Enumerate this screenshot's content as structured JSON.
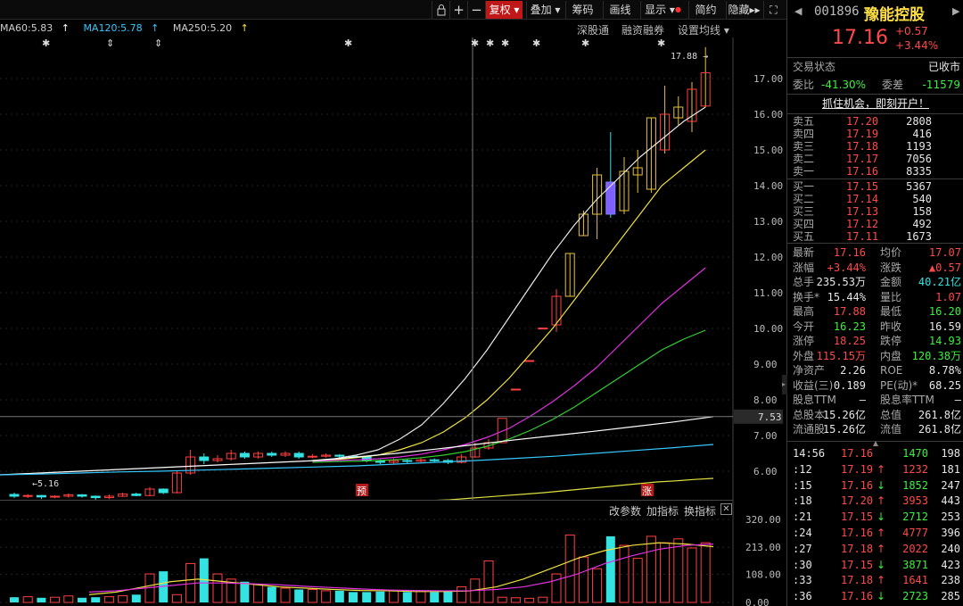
{
  "toolbar": {
    "fuquan": "复权",
    "overlay": "叠加",
    "chips": "筹码",
    "draw": "画线",
    "display": "显示",
    "simple": "简约",
    "hide": "隐藏"
  },
  "ma_legend": [
    {
      "label": "MA60:5.83",
      "color": "#ffffff"
    },
    {
      "label": "MA120:5.78",
      "color": "#35c8ff"
    },
    {
      "label": "MA250:5.20",
      "color": "#ffffff"
    }
  ],
  "links": {
    "sgt": "深股通",
    "margin": "融资融券",
    "ma_settings": "设置均线"
  },
  "kline": {
    "y_ticks": [
      "17.00",
      "16.00",
      "15.00",
      "14.00",
      "13.00",
      "12.00",
      "11.00",
      "10.00",
      "9.00",
      "8.00",
      "7.00",
      "6.00"
    ],
    "y_min": 5.4,
    "y_max": 17.9,
    "high_label": "17.88",
    "low_label": "5.16",
    "crosshair_value": "7.53",
    "markers": {
      "pre": "预",
      "up": "涨"
    },
    "candles": [
      [
        5.35,
        5.3,
        5.4,
        5.25
      ],
      [
        5.3,
        5.32,
        5.36,
        5.25
      ],
      [
        5.32,
        5.28,
        5.34,
        5.22
      ],
      [
        5.28,
        5.3,
        5.33,
        5.24
      ],
      [
        5.3,
        5.34,
        5.38,
        5.26
      ],
      [
        5.34,
        5.3,
        5.36,
        5.26
      ],
      [
        5.3,
        5.26,
        5.32,
        5.2
      ],
      [
        5.26,
        5.3,
        5.35,
        5.22
      ],
      [
        5.3,
        5.36,
        5.4,
        5.28
      ],
      [
        5.36,
        5.32,
        5.4,
        5.3
      ],
      [
        5.32,
        5.5,
        5.56,
        5.3
      ],
      [
        5.5,
        5.4,
        5.52,
        5.36
      ],
      [
        5.4,
        5.95,
        6.0,
        5.38
      ],
      [
        5.95,
        6.4,
        6.6,
        5.9
      ],
      [
        6.4,
        6.3,
        6.5,
        6.2
      ],
      [
        6.3,
        6.35,
        6.45,
        6.25
      ],
      [
        6.35,
        6.5,
        6.6,
        6.3
      ],
      [
        6.5,
        6.4,
        6.55,
        6.35
      ],
      [
        6.4,
        6.5,
        6.55,
        6.35
      ],
      [
        6.5,
        6.45,
        6.55,
        6.4
      ],
      [
        6.45,
        6.5,
        6.56,
        6.4
      ],
      [
        6.5,
        6.4,
        6.55,
        6.35
      ],
      [
        6.4,
        6.42,
        6.48,
        6.36
      ],
      [
        6.42,
        6.45,
        6.5,
        6.38
      ],
      [
        6.45,
        6.42,
        6.48,
        6.38
      ],
      [
        6.42,
        6.4,
        6.46,
        6.36
      ],
      [
        6.4,
        6.3,
        6.42,
        6.25
      ],
      [
        6.3,
        6.25,
        6.33,
        6.2
      ],
      [
        6.25,
        6.3,
        6.36,
        6.2
      ],
      [
        6.3,
        6.28,
        6.34,
        6.22
      ],
      [
        6.28,
        6.32,
        6.38,
        6.25
      ],
      [
        6.32,
        6.3,
        6.36,
        6.26
      ],
      [
        6.3,
        6.25,
        6.34,
        6.2
      ],
      [
        6.25,
        6.4,
        6.48,
        6.22
      ],
      [
        6.4,
        6.65,
        6.8,
        6.38
      ],
      [
        6.65,
        6.8,
        6.9,
        6.6
      ],
      [
        6.8,
        7.48,
        7.48,
        7.48
      ],
      [
        8.3,
        8.3,
        8.3,
        8.3
      ],
      [
        9.1,
        9.1,
        9.1,
        9.1
      ],
      [
        10.01,
        10.01,
        10.01,
        10.01
      ],
      [
        10.1,
        10.9,
        11.1,
        9.9
      ],
      [
        10.9,
        12.1,
        12.1,
        10.9
      ],
      [
        12.6,
        13.2,
        13.3,
        12.6
      ],
      [
        13.2,
        14.3,
        14.5,
        12.5
      ],
      [
        14.1,
        13.2,
        15.5,
        13.1
      ],
      [
        13.3,
        14.4,
        14.8,
        13.2
      ],
      [
        14.3,
        14.5,
        15.0,
        13.8
      ],
      [
        13.9,
        15.9,
        15.9,
        13.8
      ],
      [
        15.0,
        16.0,
        16.8,
        14.9
      ],
      [
        15.9,
        16.2,
        16.5,
        15.7
      ],
      [
        15.8,
        16.7,
        16.9,
        15.5
      ],
      [
        16.23,
        17.16,
        17.88,
        16.2
      ]
    ],
    "ma_series": [
      {
        "name": "MA5",
        "color": "#e8e8e8",
        "values": [
          6.3,
          6.35,
          6.45,
          6.6,
          6.9,
          7.3,
          7.9,
          8.6,
          9.4,
          10.3,
          11.2,
          12.1,
          12.9,
          13.6,
          14.2,
          14.8,
          15.3,
          15.8,
          16.2
        ]
      },
      {
        "name": "MA10",
        "color": "#f0e040",
        "values": [
          6.3,
          6.32,
          6.38,
          6.45,
          6.6,
          6.8,
          7.1,
          7.5,
          8.0,
          8.6,
          9.3,
          10.0,
          10.8,
          11.6,
          12.4,
          13.2,
          14.0,
          14.5,
          15.0
        ]
      },
      {
        "name": "MA20",
        "color": "#e030e0",
        "values": [
          6.28,
          6.3,
          6.32,
          6.35,
          6.4,
          6.48,
          6.6,
          6.75,
          6.95,
          7.2,
          7.55,
          7.95,
          8.4,
          8.9,
          9.5,
          10.1,
          10.7,
          11.2,
          11.7
        ]
      },
      {
        "name": "MA30",
        "color": "#30d030",
        "values": [
          6.25,
          6.27,
          6.28,
          6.3,
          6.33,
          6.38,
          6.45,
          6.55,
          6.7,
          6.9,
          7.15,
          7.45,
          7.8,
          8.2,
          8.6,
          9.0,
          9.4,
          9.7,
          9.95
        ]
      }
    ],
    "ma60": {
      "color": "#ffffff",
      "values": [
        5.9,
        5.95,
        6.0,
        6.05,
        6.1,
        6.15,
        6.2,
        6.25,
        6.3,
        6.4,
        6.5,
        6.62,
        6.75,
        6.88,
        7.0,
        7.12,
        7.25,
        7.38,
        7.53
      ]
    },
    "ma120": {
      "color": "#35c8ff",
      "values": [
        5.9,
        5.92,
        5.95,
        5.98,
        6.0,
        6.03,
        6.06,
        6.09,
        6.12,
        6.15,
        6.2,
        6.25,
        6.3,
        6.36,
        6.42,
        6.5,
        6.58,
        6.66,
        6.75
      ]
    },
    "ma250": {
      "color": "#e0e040",
      "values": [
        5.1,
        5.12,
        5.15,
        5.18,
        5.2,
        5.24,
        5.28,
        5.32,
        5.36,
        5.4,
        5.45,
        5.5,
        5.55,
        5.6,
        5.65,
        5.7,
        5.73,
        5.77,
        5.8
      ]
    }
  },
  "volume": {
    "links": {
      "params": "改参数",
      "add": "加指标",
      "switch": "换指标"
    },
    "y_ticks": [
      "320.00",
      "213.00",
      "108.00",
      "0.00"
    ],
    "y_max": 320,
    "bars": [
      20,
      22,
      18,
      20,
      25,
      18,
      20,
      22,
      26,
      30,
      110,
      120,
      30,
      150,
      170,
      110,
      90,
      80,
      70,
      60,
      55,
      50,
      50,
      45,
      45,
      40,
      40,
      42,
      45,
      40,
      42,
      40,
      45,
      60,
      90,
      160,
      20,
      18,
      16,
      20,
      110,
      260,
      175,
      130,
      255,
      220,
      170,
      255,
      230,
      245,
      210,
      230
    ],
    "ma_a": {
      "color": "#f0e040",
      "values": [
        30,
        40,
        60,
        80,
        90,
        80,
        70,
        60,
        55,
        50,
        46,
        45,
        42,
        42,
        44,
        60,
        90,
        130,
        170,
        200,
        220,
        230,
        225,
        215
      ]
    },
    "ma_b": {
      "color": "#e030e0",
      "values": [
        40,
        45,
        55,
        65,
        75,
        75,
        72,
        68,
        62,
        57,
        52,
        48,
        46,
        45,
        45,
        50,
        60,
        80,
        110,
        150,
        180,
        205,
        220,
        225
      ]
    }
  },
  "quote": {
    "code": "001896",
    "name": "豫能控股",
    "price": "17.16",
    "change": "+0.57",
    "change_pct": "+3.44%",
    "status_label": "交易状态",
    "status_value": "已收市",
    "ratio_label": "委比",
    "ratio_value": "-41.30%",
    "diff_label": "委差",
    "diff_value": "-11579",
    "promo": "抓住机会，即刻开户！",
    "asks": [
      {
        "label": "卖五",
        "price": "17.20",
        "vol": "2808"
      },
      {
        "label": "卖四",
        "price": "17.19",
        "vol": "416"
      },
      {
        "label": "卖三",
        "price": "17.18",
        "vol": "1193"
      },
      {
        "label": "卖二",
        "price": "17.17",
        "vol": "7056"
      },
      {
        "label": "卖一",
        "price": "17.16",
        "vol": "8335"
      }
    ],
    "bids": [
      {
        "label": "买一",
        "price": "17.15",
        "vol": "5367"
      },
      {
        "label": "买二",
        "price": "17.14",
        "vol": "540"
      },
      {
        "label": "买三",
        "price": "17.13",
        "vol": "158"
      },
      {
        "label": "买四",
        "price": "17.12",
        "vol": "492"
      },
      {
        "label": "买五",
        "price": "17.11",
        "vol": "1673"
      }
    ],
    "stats": [
      {
        "l1": "最新",
        "v1": "17.16",
        "c1": "red",
        "l2": "均价",
        "v2": "17.07",
        "c2": "red"
      },
      {
        "l1": "涨幅",
        "v1": "+3.44%",
        "c1": "red",
        "l2": "涨跌",
        "v2": "▲0.57",
        "c2": "red"
      },
      {
        "l1": "总手",
        "v1": "235.53万",
        "c1": "white",
        "l2": "金额",
        "v2": "40.21亿",
        "c2": "cyan"
      },
      {
        "l1": "换手*",
        "v1": "15.44%",
        "c1": "white",
        "l2": "量比",
        "v2": "1.07",
        "c2": "red"
      },
      {
        "l1": "最高",
        "v1": "17.88",
        "c1": "red",
        "l2": "最低",
        "v2": "16.20",
        "c2": "green"
      },
      {
        "l1": "今开",
        "v1": "16.23",
        "c1": "green",
        "l2": "昨收",
        "v2": "16.59",
        "c2": "white"
      },
      {
        "l1": "涨停",
        "v1": "18.25",
        "c1": "red",
        "l2": "跌停",
        "v2": "14.93",
        "c2": "green"
      },
      {
        "l1": "外盘",
        "v1": "115.15万",
        "c1": "red",
        "l2": "内盘",
        "v2": "120.38万",
        "c2": "green"
      },
      {
        "l1": "净资产",
        "v1": "2.26",
        "c1": "white",
        "l2": "ROE",
        "v2": "8.78%",
        "c2": "white"
      },
      {
        "l1": "收益(三)",
        "v1": "0.189",
        "c1": "white",
        "l2": "PE(动)*",
        "v2": "68.25",
        "c2": "white"
      },
      {
        "l1": "股息TTM",
        "v1": "—",
        "c1": "white",
        "l2": "股息率TTM",
        "v2": "—",
        "c2": "white"
      },
      {
        "l1": "总股本",
        "v1": "15.26亿",
        "c1": "white",
        "l2": "总值",
        "v2": "261.8亿",
        "c2": "white"
      },
      {
        "l1": "流通股",
        "v1": "15.26亿",
        "c1": "white",
        "l2": "流值",
        "v2": "261.8亿",
        "c2": "white"
      }
    ],
    "ticks": [
      {
        "time": "14:56",
        "price": "17.16",
        "dir": "",
        "vol": "1470",
        "num": "198",
        "vcolor": "green"
      },
      {
        "time": ":12",
        "price": "17.19",
        "dir": "↑",
        "vol": "1232",
        "num": "181",
        "vcolor": "red"
      },
      {
        "time": ":15",
        "price": "17.16",
        "dir": "↓",
        "vol": "1852",
        "num": "247",
        "vcolor": "green"
      },
      {
        "time": ":18",
        "price": "17.20",
        "dir": "↑",
        "vol": "3953",
        "num": "443",
        "vcolor": "red"
      },
      {
        "time": ":21",
        "price": "17.15",
        "dir": "↓",
        "vol": "2712",
        "num": "253",
        "vcolor": "green"
      },
      {
        "time": ":24",
        "price": "17.16",
        "dir": "↑",
        "vol": "4777",
        "num": "396",
        "vcolor": "red"
      },
      {
        "time": ":27",
        "price": "17.18",
        "dir": "↑",
        "vol": "2022",
        "num": "240",
        "vcolor": "red"
      },
      {
        "time": ":30",
        "price": "17.15",
        "dir": "↓",
        "vol": "3871",
        "num": "423",
        "vcolor": "green"
      },
      {
        "time": ":33",
        "price": "17.18",
        "dir": "↑",
        "vol": "1641",
        "num": "238",
        "vcolor": "red"
      },
      {
        "time": ":36",
        "price": "17.16",
        "dir": "↓",
        "vol": "2723",
        "num": "285",
        "vcolor": "green"
      }
    ]
  }
}
